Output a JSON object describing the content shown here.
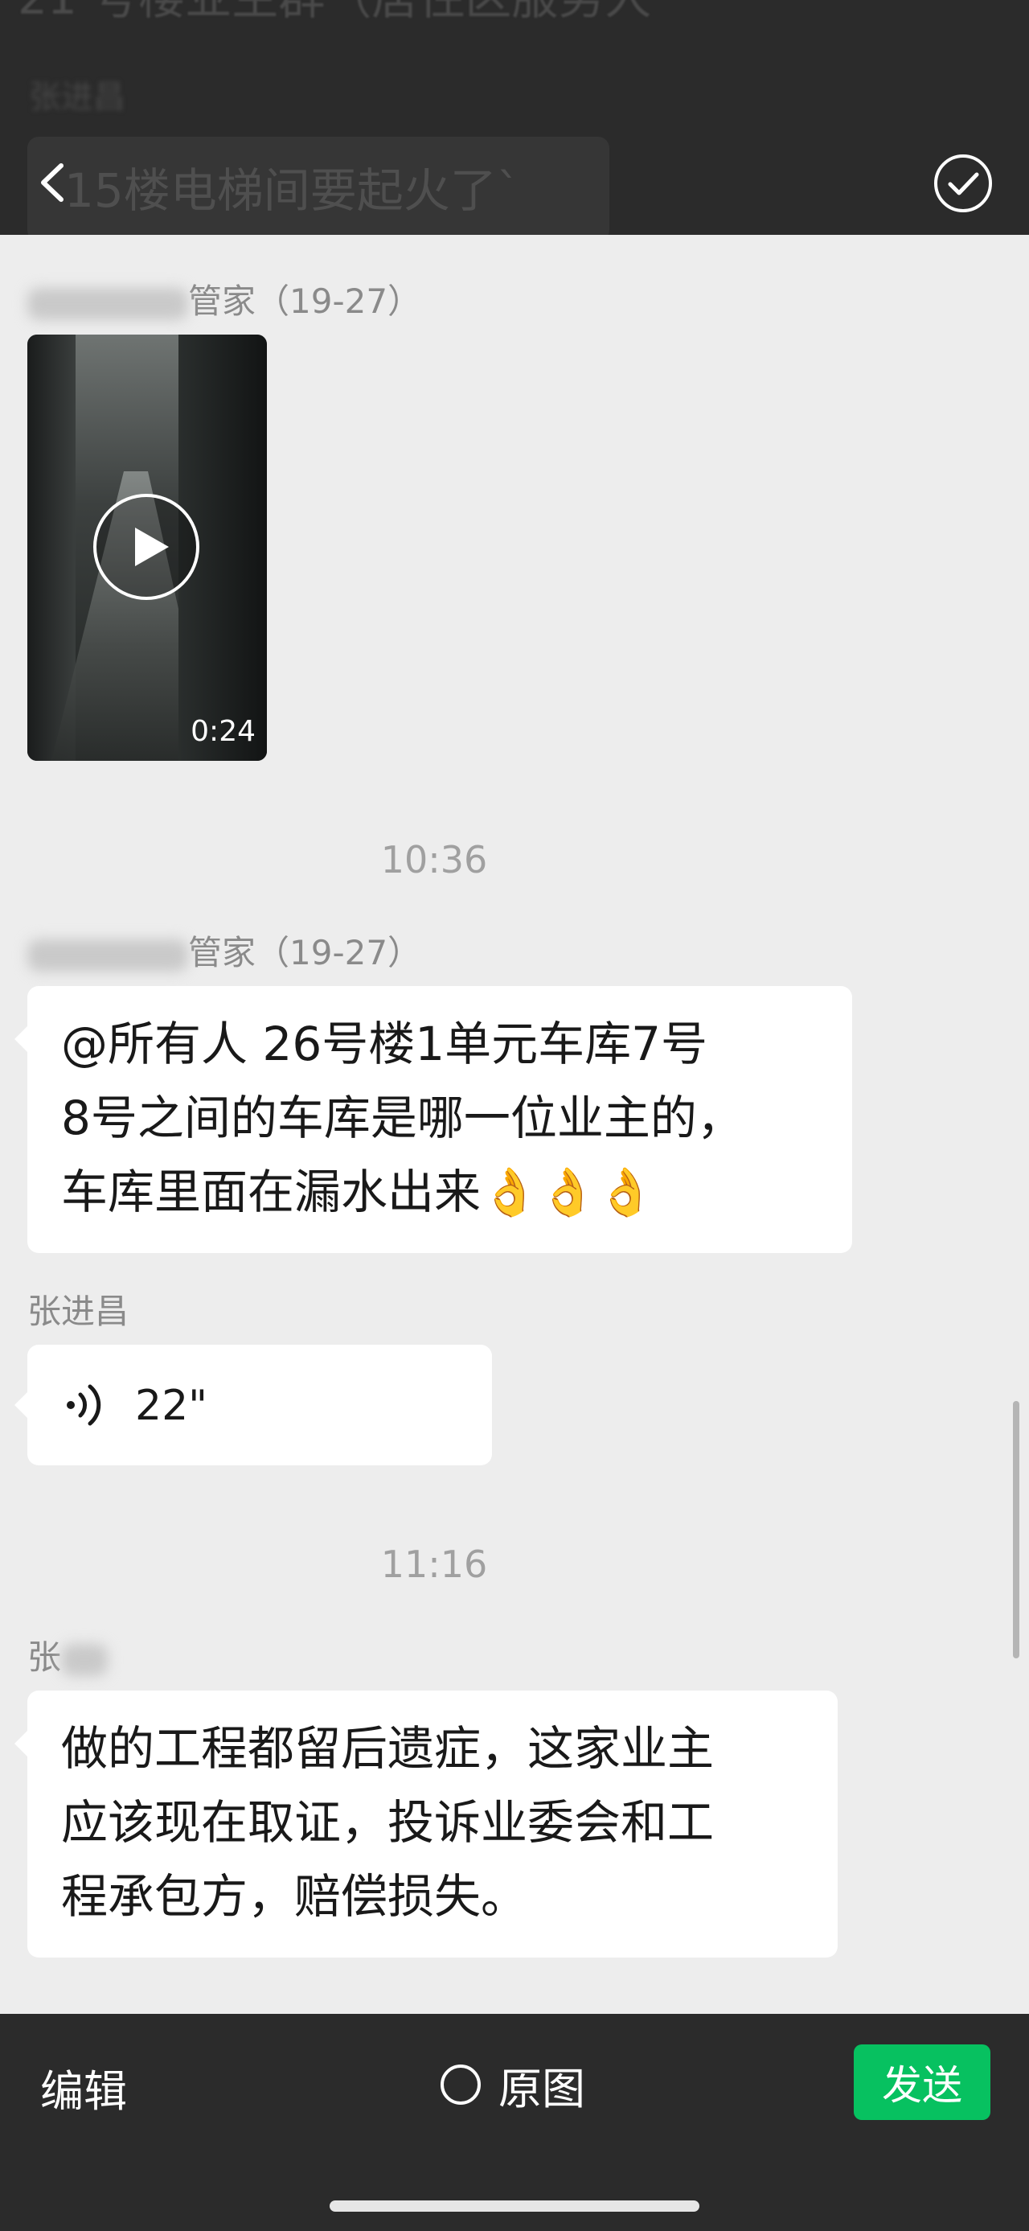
{
  "header": {
    "ghost_title": "21 号楼业主群（居住区服务人",
    "ghost_sender": "张进昌",
    "ghost_message": "15楼电梯间要起火了`",
    "back_icon": "chevron-left-icon",
    "confirm_icon": "check-circle-icon"
  },
  "messages": {
    "sender1_suffix": "管家（19-27）",
    "video_duration": "0:24",
    "time1": "10:36",
    "sender2_suffix": "管家（19-27）",
    "text_message_lines": [
      "@所有人 26号楼1单元车库7号",
      "8号之间的车库是哪一位业主的，",
      "车库里面在漏水出来👌👌👌"
    ],
    "sender3": "张进昌",
    "voice_duration": "22\"",
    "time2": "11:16",
    "sender4_visible": "张",
    "reply_lines": [
      "做的工程都留后遗症，这家业主",
      "应该现在取证，投诉业委会和工",
      "程承包方，赔偿损失。"
    ]
  },
  "bottom_bar": {
    "edit_label": "编辑",
    "original_label": "原图",
    "send_label": "发送",
    "send_color": "#07c160"
  }
}
